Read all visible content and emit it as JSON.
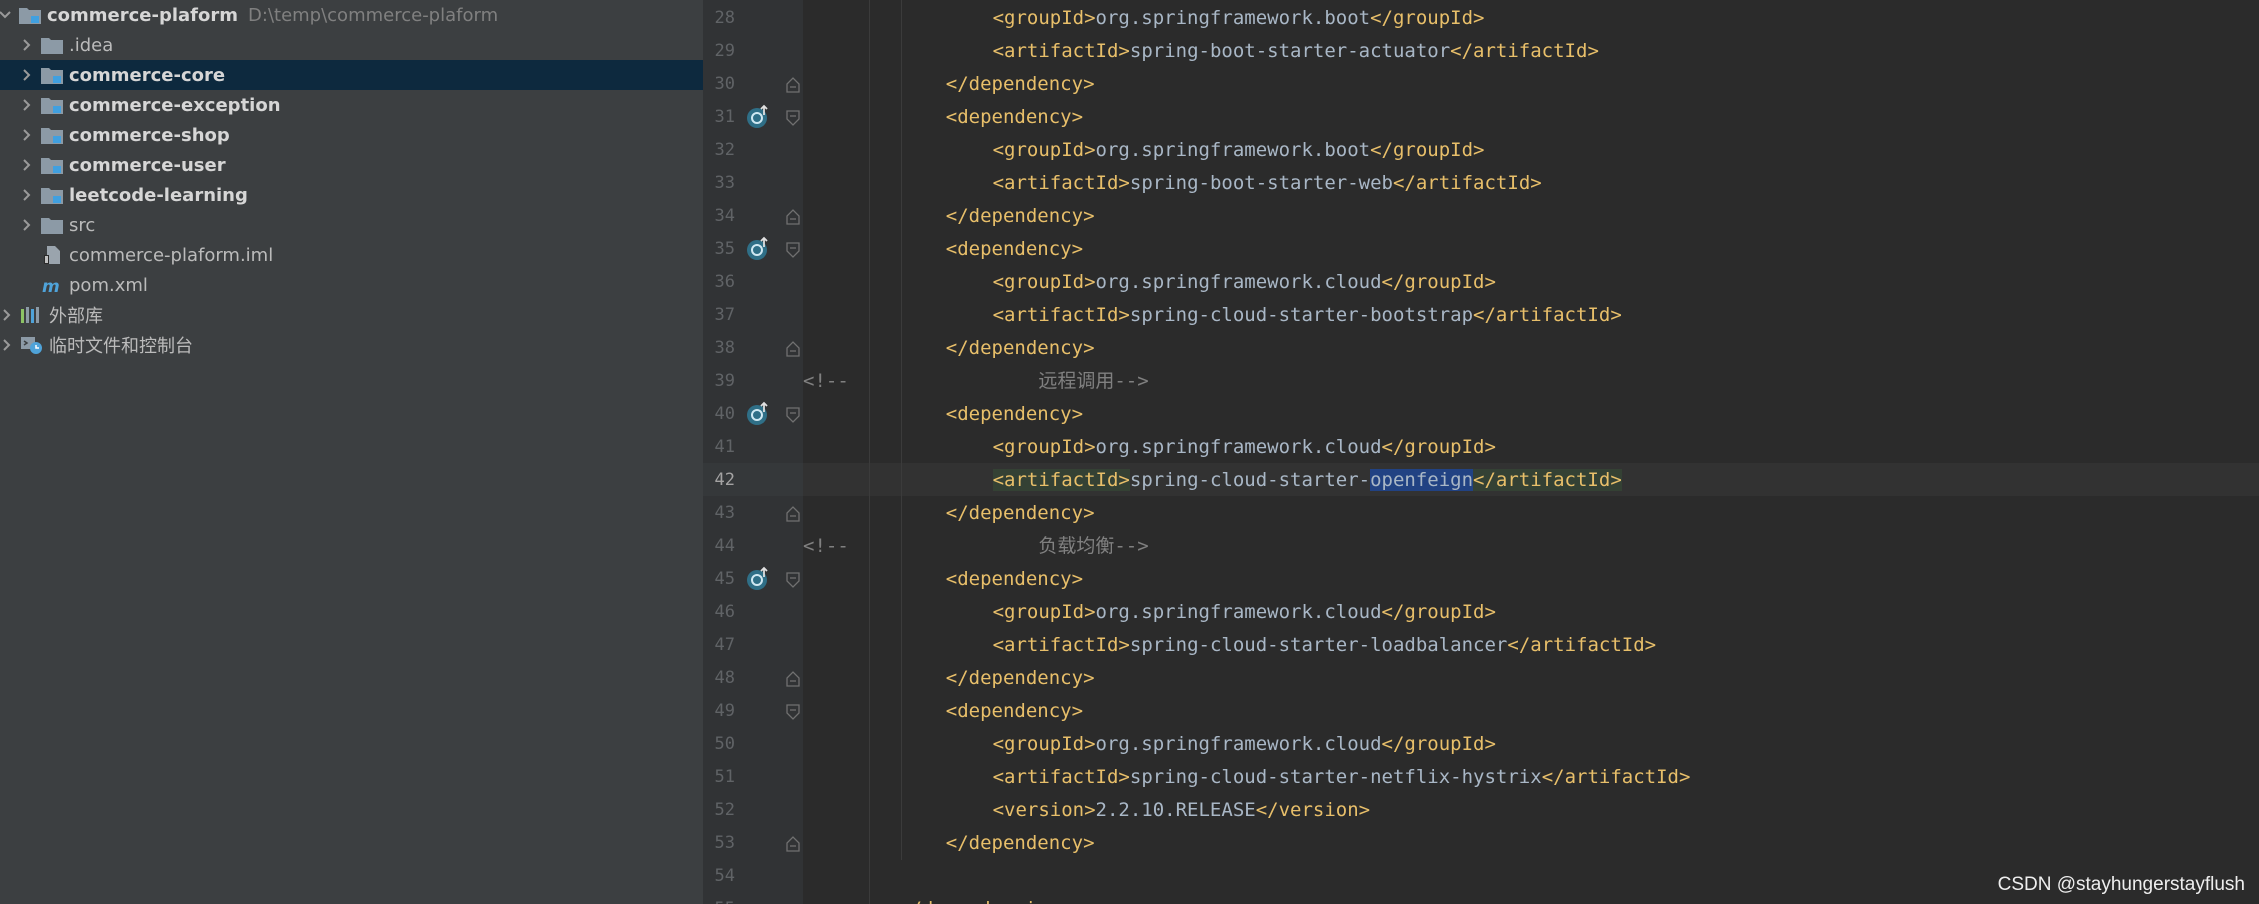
{
  "project_tree": {
    "root": {
      "name": "commerce-plaform",
      "path": "D:\\temp\\commerce-plaform",
      "icon": "module-folder-icon"
    },
    "items": [
      {
        "label": ".idea",
        "icon": "folder-icon",
        "bold": false,
        "expandable": true
      },
      {
        "label": "commerce-core",
        "icon": "module-folder-icon",
        "bold": true,
        "expandable": true,
        "selected": true
      },
      {
        "label": "commerce-exception",
        "icon": "module-folder-icon",
        "bold": true,
        "expandable": true
      },
      {
        "label": "commerce-shop",
        "icon": "module-folder-icon",
        "bold": true,
        "expandable": true
      },
      {
        "label": "commerce-user",
        "icon": "module-folder-icon",
        "bold": true,
        "expandable": true
      },
      {
        "label": "leetcode-learning",
        "icon": "module-folder-icon",
        "bold": true,
        "expandable": true
      },
      {
        "label": "src",
        "icon": "folder-icon",
        "bold": false,
        "expandable": true
      },
      {
        "label": "commerce-plaform.iml",
        "icon": "iml-file-icon",
        "bold": false,
        "expandable": false
      },
      {
        "label": "pom.xml",
        "icon": "maven-file-icon",
        "bold": false,
        "expandable": false
      }
    ],
    "external_libraries": {
      "label": "外部库",
      "icon": "library-icon"
    },
    "scratches": {
      "label": "临时文件和控制台",
      "icon": "scratches-icon"
    }
  },
  "editor": {
    "current_line": 42,
    "lines": [
      {
        "n": 28,
        "indent": 3,
        "tag": "groupId",
        "value": "org.springframework.boot"
      },
      {
        "n": 29,
        "indent": 3,
        "tag": "artifactId",
        "value": "spring-boot-starter-actuator"
      },
      {
        "n": 30,
        "indent": 2,
        "close": "dependency"
      },
      {
        "n": 31,
        "indent": 2,
        "open": "dependency"
      },
      {
        "n": 32,
        "indent": 3,
        "tag": "groupId",
        "value": "org.springframework.boot"
      },
      {
        "n": 33,
        "indent": 3,
        "tag": "artifactId",
        "value": "spring-boot-starter-web"
      },
      {
        "n": 34,
        "indent": 2,
        "close": "dependency"
      },
      {
        "n": 35,
        "indent": 2,
        "open": "dependency"
      },
      {
        "n": 36,
        "indent": 3,
        "tag": "groupId",
        "value": "org.springframework.cloud"
      },
      {
        "n": 37,
        "indent": 3,
        "tag": "artifactId",
        "value": "spring-cloud-starter-bootstrap"
      },
      {
        "n": 38,
        "indent": 2,
        "close": "dependency"
      },
      {
        "n": 39,
        "comment_open": "<!--",
        "comment_text": "远程调用-->"
      },
      {
        "n": 40,
        "indent": 2,
        "open": "dependency"
      },
      {
        "n": 41,
        "indent": 3,
        "tag": "groupId",
        "value": "org.springframework.cloud"
      },
      {
        "n": 42,
        "indent": 3,
        "tag": "artifactId",
        "value_prefix": "spring-cloud-starter-",
        "value_highlight": "openfeign"
      },
      {
        "n": 43,
        "indent": 2,
        "close": "dependency"
      },
      {
        "n": 44,
        "comment_open": "<!--",
        "comment_text": "负载均衡-->"
      },
      {
        "n": 45,
        "indent": 2,
        "open": "dependency"
      },
      {
        "n": 46,
        "indent": 3,
        "tag": "groupId",
        "value": "org.springframework.cloud"
      },
      {
        "n": 47,
        "indent": 3,
        "tag": "artifactId",
        "value": "spring-cloud-starter-loadbalancer"
      },
      {
        "n": 48,
        "indent": 2,
        "close": "dependency"
      },
      {
        "n": 49,
        "indent": 2,
        "open": "dependency"
      },
      {
        "n": 50,
        "indent": 3,
        "tag": "groupId",
        "value": "org.springframework.cloud"
      },
      {
        "n": 51,
        "indent": 3,
        "tag": "artifactId",
        "value": "spring-cloud-starter-netflix-hystrix"
      },
      {
        "n": 52,
        "indent": 3,
        "tag": "version",
        "value": "2.2.10.RELEASE"
      },
      {
        "n": 53,
        "indent": 2,
        "close": "dependency"
      },
      {
        "n": 54,
        "blank": true
      },
      {
        "n": 55,
        "indent": 1,
        "partial": "</dependencies>"
      }
    ],
    "gutter_markers": [
      31,
      35,
      40,
      45
    ],
    "gutter_marker_icon": "implemented-override-icon"
  },
  "watermark": "CSDN @stayhungerstayflush",
  "colors": {
    "panel_bg": "#3c3f41",
    "editor_bg": "#2b2b2b",
    "selection": "#0d293e",
    "tag": "#e8bf6a",
    "text": "#a9b7c6",
    "comment": "#808080",
    "word_highlight": "#214283"
  }
}
